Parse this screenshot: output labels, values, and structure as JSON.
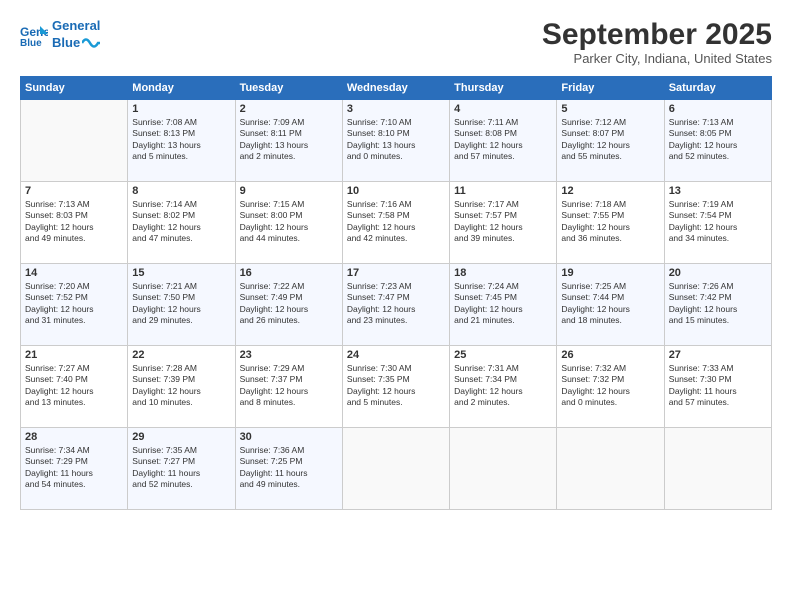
{
  "header": {
    "logo_line1": "General",
    "logo_line2": "Blue",
    "month_title": "September 2025",
    "location": "Parker City, Indiana, United States"
  },
  "weekdays": [
    "Sunday",
    "Monday",
    "Tuesday",
    "Wednesday",
    "Thursday",
    "Friday",
    "Saturday"
  ],
  "weeks": [
    [
      {
        "day": "",
        "info": ""
      },
      {
        "day": "1",
        "info": "Sunrise: 7:08 AM\nSunset: 8:13 PM\nDaylight: 13 hours\nand 5 minutes."
      },
      {
        "day": "2",
        "info": "Sunrise: 7:09 AM\nSunset: 8:11 PM\nDaylight: 13 hours\nand 2 minutes."
      },
      {
        "day": "3",
        "info": "Sunrise: 7:10 AM\nSunset: 8:10 PM\nDaylight: 13 hours\nand 0 minutes."
      },
      {
        "day": "4",
        "info": "Sunrise: 7:11 AM\nSunset: 8:08 PM\nDaylight: 12 hours\nand 57 minutes."
      },
      {
        "day": "5",
        "info": "Sunrise: 7:12 AM\nSunset: 8:07 PM\nDaylight: 12 hours\nand 55 minutes."
      },
      {
        "day": "6",
        "info": "Sunrise: 7:13 AM\nSunset: 8:05 PM\nDaylight: 12 hours\nand 52 minutes."
      }
    ],
    [
      {
        "day": "7",
        "info": "Sunrise: 7:13 AM\nSunset: 8:03 PM\nDaylight: 12 hours\nand 49 minutes."
      },
      {
        "day": "8",
        "info": "Sunrise: 7:14 AM\nSunset: 8:02 PM\nDaylight: 12 hours\nand 47 minutes."
      },
      {
        "day": "9",
        "info": "Sunrise: 7:15 AM\nSunset: 8:00 PM\nDaylight: 12 hours\nand 44 minutes."
      },
      {
        "day": "10",
        "info": "Sunrise: 7:16 AM\nSunset: 7:58 PM\nDaylight: 12 hours\nand 42 minutes."
      },
      {
        "day": "11",
        "info": "Sunrise: 7:17 AM\nSunset: 7:57 PM\nDaylight: 12 hours\nand 39 minutes."
      },
      {
        "day": "12",
        "info": "Sunrise: 7:18 AM\nSunset: 7:55 PM\nDaylight: 12 hours\nand 36 minutes."
      },
      {
        "day": "13",
        "info": "Sunrise: 7:19 AM\nSunset: 7:54 PM\nDaylight: 12 hours\nand 34 minutes."
      }
    ],
    [
      {
        "day": "14",
        "info": "Sunrise: 7:20 AM\nSunset: 7:52 PM\nDaylight: 12 hours\nand 31 minutes."
      },
      {
        "day": "15",
        "info": "Sunrise: 7:21 AM\nSunset: 7:50 PM\nDaylight: 12 hours\nand 29 minutes."
      },
      {
        "day": "16",
        "info": "Sunrise: 7:22 AM\nSunset: 7:49 PM\nDaylight: 12 hours\nand 26 minutes."
      },
      {
        "day": "17",
        "info": "Sunrise: 7:23 AM\nSunset: 7:47 PM\nDaylight: 12 hours\nand 23 minutes."
      },
      {
        "day": "18",
        "info": "Sunrise: 7:24 AM\nSunset: 7:45 PM\nDaylight: 12 hours\nand 21 minutes."
      },
      {
        "day": "19",
        "info": "Sunrise: 7:25 AM\nSunset: 7:44 PM\nDaylight: 12 hours\nand 18 minutes."
      },
      {
        "day": "20",
        "info": "Sunrise: 7:26 AM\nSunset: 7:42 PM\nDaylight: 12 hours\nand 15 minutes."
      }
    ],
    [
      {
        "day": "21",
        "info": "Sunrise: 7:27 AM\nSunset: 7:40 PM\nDaylight: 12 hours\nand 13 minutes."
      },
      {
        "day": "22",
        "info": "Sunrise: 7:28 AM\nSunset: 7:39 PM\nDaylight: 12 hours\nand 10 minutes."
      },
      {
        "day": "23",
        "info": "Sunrise: 7:29 AM\nSunset: 7:37 PM\nDaylight: 12 hours\nand 8 minutes."
      },
      {
        "day": "24",
        "info": "Sunrise: 7:30 AM\nSunset: 7:35 PM\nDaylight: 12 hours\nand 5 minutes."
      },
      {
        "day": "25",
        "info": "Sunrise: 7:31 AM\nSunset: 7:34 PM\nDaylight: 12 hours\nand 2 minutes."
      },
      {
        "day": "26",
        "info": "Sunrise: 7:32 AM\nSunset: 7:32 PM\nDaylight: 12 hours\nand 0 minutes."
      },
      {
        "day": "27",
        "info": "Sunrise: 7:33 AM\nSunset: 7:30 PM\nDaylight: 11 hours\nand 57 minutes."
      }
    ],
    [
      {
        "day": "28",
        "info": "Sunrise: 7:34 AM\nSunset: 7:29 PM\nDaylight: 11 hours\nand 54 minutes."
      },
      {
        "day": "29",
        "info": "Sunrise: 7:35 AM\nSunset: 7:27 PM\nDaylight: 11 hours\nand 52 minutes."
      },
      {
        "day": "30",
        "info": "Sunrise: 7:36 AM\nSunset: 7:25 PM\nDaylight: 11 hours\nand 49 minutes."
      },
      {
        "day": "",
        "info": ""
      },
      {
        "day": "",
        "info": ""
      },
      {
        "day": "",
        "info": ""
      },
      {
        "day": "",
        "info": ""
      }
    ]
  ]
}
